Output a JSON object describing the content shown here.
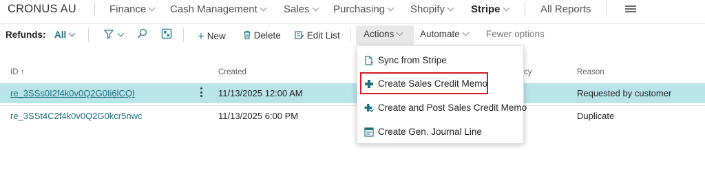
{
  "topnav": {
    "company": "CRONUS AU",
    "items": [
      "Finance",
      "Cash Management",
      "Sales",
      "Purchasing",
      "Shopify",
      "Stripe"
    ],
    "all_reports": "All Reports"
  },
  "actionbar": {
    "page_label": "Refunds:",
    "view_filter": "All",
    "new": "New",
    "delete": "Delete",
    "edit_list": "Edit List",
    "actions": "Actions",
    "automate": "Automate",
    "fewer_options": "Fewer options"
  },
  "table": {
    "columns": {
      "id": "ID",
      "sort_indicator": "↑",
      "created": "Created",
      "currency_fragment": "cy",
      "reason": "Reason"
    },
    "rows": [
      {
        "id": "re_3SSs0I2f4k0v0Q2G0Ii6lCQI",
        "created": "11/13/2025 12:00 AM",
        "reason": "Requested by customer"
      },
      {
        "id": "re_3SSt4C2f4k0v0Q2G0kcr5nwc",
        "created": "11/13/2025 6:00 PM",
        "reason": "Duplicate"
      }
    ]
  },
  "actions_menu": {
    "items": [
      {
        "label": "Sync from Stripe",
        "icon": "document-sync-icon"
      },
      {
        "label": "Create Sales Credit Memo",
        "icon": "plus-icon"
      },
      {
        "label": "Create and Post Sales Credit Memo",
        "icon": "plus-post-icon"
      },
      {
        "label": "Create Gen. Journal Line",
        "icon": "journal-icon"
      }
    ],
    "highlighted_index": 1
  },
  "colors": {
    "accent_teal": "#1f6f7f",
    "selected_row": "#b8e4ea",
    "highlight_red": "#d3191f"
  }
}
